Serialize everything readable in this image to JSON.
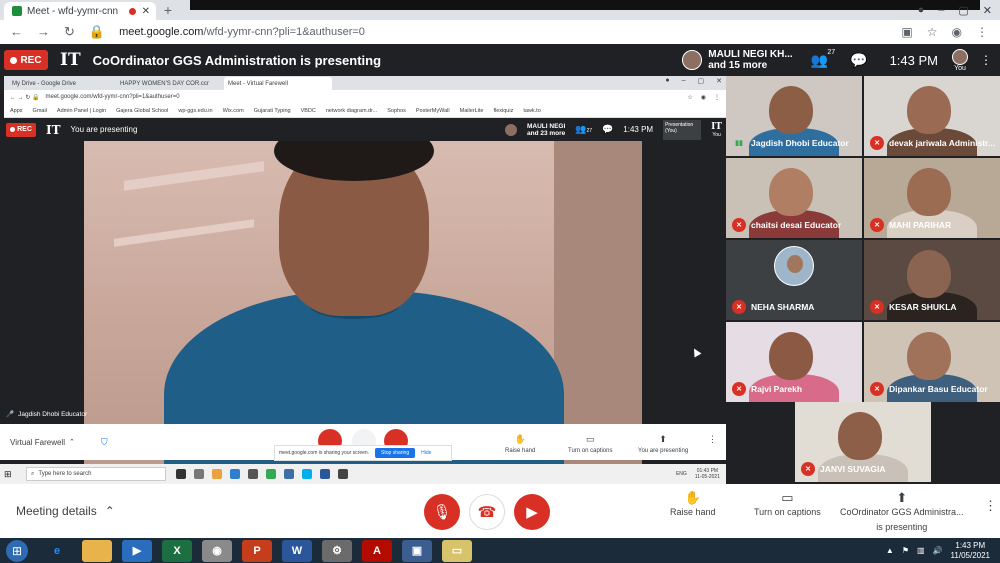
{
  "browser": {
    "tab_title": "Meet - wfd-yymr-cnn",
    "url_host": "meet.google.com",
    "url_path": "/wfd-yymr-cnn?pli=1&authuser=0"
  },
  "meet_header": {
    "rec_label": "REC",
    "logo": "IT",
    "presenting_text": "CoOrdinator GGS Administration is presenting",
    "presenter_name": "MAULI NEGI KH...",
    "presenter_more": "and 15 more",
    "people_count": "27",
    "time": "1:43 PM",
    "you_label": "You"
  },
  "inner": {
    "tabs": [
      "My Drive - Google Drive",
      "HAPPY WOMEN'S DAY COR.ccr",
      "Meet - Virtual Farewell"
    ],
    "url": "meet.google.com/wfd-yymr-cnn?pli=1&authuser=0",
    "bookmarks": [
      "Apps",
      "Gmail",
      "Admin Panel | Login",
      "Gajera Global School",
      "wp-ggs.edu.in",
      "Wix.com",
      "Gujarati Typing",
      "VBDC",
      "network diagram.dr...",
      "Sophos",
      "PosterMyWall",
      "MailerLite",
      "flexiquiz",
      "tawk.to"
    ],
    "rec_label": "REC",
    "logo": "IT",
    "you_presenting": "You are presenting",
    "presenter_name": "MAULI NEGI",
    "presenter_more": "and 23 more",
    "people_count": "27",
    "time": "1:43 PM",
    "presentation_tile": "Presentation (You)",
    "you_label": "You",
    "speaker_label": "Jagdish Dhobi Educator",
    "meeting_title": "Virtual Farewell",
    "share_notice": "meet.google.com is sharing your screen.",
    "stop_sharing": "Stop sharing",
    "hide": "Hide",
    "raise_hand": "Raise hand",
    "captions": "Turn on captions",
    "you_are_presenting": "You are presenting",
    "search_placeholder": "Type here to search",
    "lang": "ENG",
    "clock_time": "01:43 PM",
    "clock_date": "11-05-2021"
  },
  "participants": [
    {
      "name": "Jagdish Dhobi Educator",
      "muted": false
    },
    {
      "name": "devak jariwala Administr...",
      "muted": true
    },
    {
      "name": "chaitsi desai Educator",
      "muted": true
    },
    {
      "name": "MAHI PARIHAR",
      "muted": true
    },
    {
      "name": "NEHA SHARMA",
      "muted": true
    },
    {
      "name": "KESAR SHUKLA",
      "muted": true
    },
    {
      "name": "Rajvi Parekh",
      "muted": true
    },
    {
      "name": "Dipankar Basu Educator",
      "muted": true
    },
    {
      "name": "JANVI SUVAGIA",
      "muted": true
    }
  ],
  "bottom": {
    "meeting_details": "Meeting details",
    "raise_hand": "Raise hand",
    "captions": "Turn on captions",
    "presenter_line1": "CoOrdinator GGS Administra...",
    "presenter_line2": "is presenting"
  },
  "taskbar": {
    "time": "1:43 PM",
    "date": "11/05/2021"
  },
  "colors": {
    "meet_bg": "#202124",
    "rec_red": "#d93025",
    "accent_blue": "#1a73e8"
  }
}
